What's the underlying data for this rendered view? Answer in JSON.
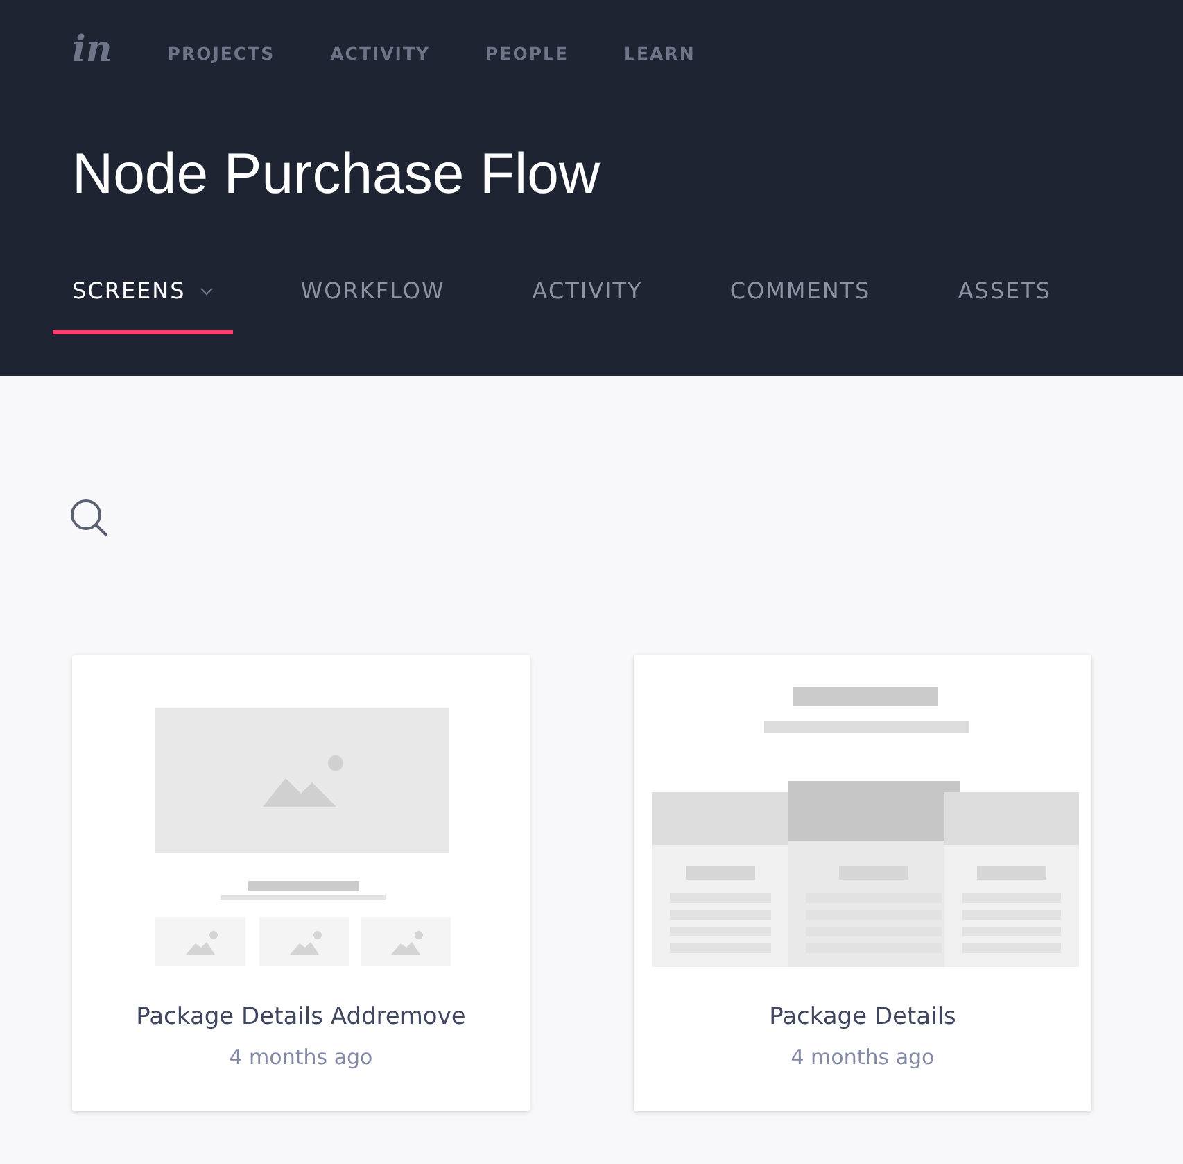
{
  "logo": "in",
  "top_nav": [
    {
      "label": "PROJECTS"
    },
    {
      "label": "ACTIVITY"
    },
    {
      "label": "PEOPLE"
    },
    {
      "label": "LEARN"
    }
  ],
  "project_title": "Node Purchase Flow",
  "tabs": [
    {
      "label": "SCREENS",
      "selected": true,
      "dropdown": true
    },
    {
      "label": "WORKFLOW",
      "selected": false
    },
    {
      "label": "ACTIVITY",
      "selected": false
    },
    {
      "label": "COMMENTS",
      "selected": false
    },
    {
      "label": "ASSETS",
      "selected": false
    }
  ],
  "screens": [
    {
      "name": "Package Details Addremove",
      "updated": "4 months ago",
      "kind": "media"
    },
    {
      "name": "Package Details",
      "updated": "4 months ago",
      "kind": "pricing"
    }
  ]
}
